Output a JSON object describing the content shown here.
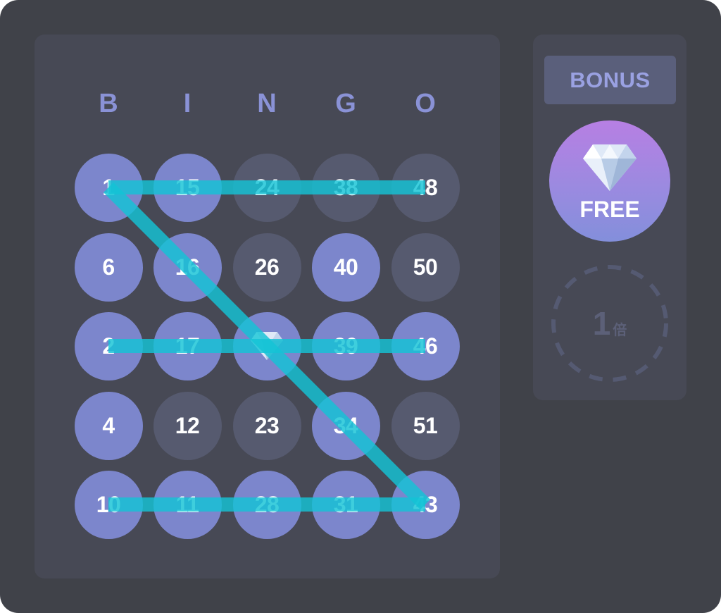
{
  "header": [
    "B",
    "I",
    "N",
    "G",
    "O"
  ],
  "rows": [
    [
      {
        "n": "1",
        "marked": true
      },
      {
        "n": "15",
        "marked": true
      },
      {
        "n": "24",
        "marked": false
      },
      {
        "n": "38",
        "marked": false
      },
      {
        "n": "48",
        "marked": false
      }
    ],
    [
      {
        "n": "6",
        "marked": true
      },
      {
        "n": "16",
        "marked": true
      },
      {
        "n": "26",
        "marked": false
      },
      {
        "n": "40",
        "marked": true
      },
      {
        "n": "50",
        "marked": false
      }
    ],
    [
      {
        "n": "2",
        "marked": true
      },
      {
        "n": "17",
        "marked": true
      },
      {
        "n": "",
        "marked": true,
        "gem": true
      },
      {
        "n": "39",
        "marked": true
      },
      {
        "n": "46",
        "marked": true
      }
    ],
    [
      {
        "n": "4",
        "marked": true
      },
      {
        "n": "12",
        "marked": false
      },
      {
        "n": "23",
        "marked": false
      },
      {
        "n": "34",
        "marked": true
      },
      {
        "n": "51",
        "marked": false
      }
    ],
    [
      {
        "n": "10",
        "marked": true
      },
      {
        "n": "11",
        "marked": true
      },
      {
        "n": "28",
        "marked": true
      },
      {
        "n": "31",
        "marked": true
      },
      {
        "n": "43",
        "marked": true
      }
    ]
  ],
  "winning_lines": [
    {
      "from": [
        0,
        0
      ],
      "to": [
        4,
        4
      ]
    },
    {
      "from": [
        0,
        0
      ],
      "to": [
        0,
        4
      ]
    },
    {
      "from": [
        2,
        0
      ],
      "to": [
        2,
        4
      ]
    },
    {
      "from": [
        4,
        0
      ],
      "to": [
        4,
        4
      ]
    }
  ],
  "bonus": {
    "label": "BONUS",
    "free_label": "FREE",
    "multiplier_value": "1",
    "multiplier_unit": "倍"
  },
  "colors": {
    "marked": "#7c86cc",
    "unmarked": "#565a6f",
    "line": "#13c3d6",
    "header": "#8a92d6"
  },
  "icons": {
    "free_spot": "diamond-icon"
  }
}
